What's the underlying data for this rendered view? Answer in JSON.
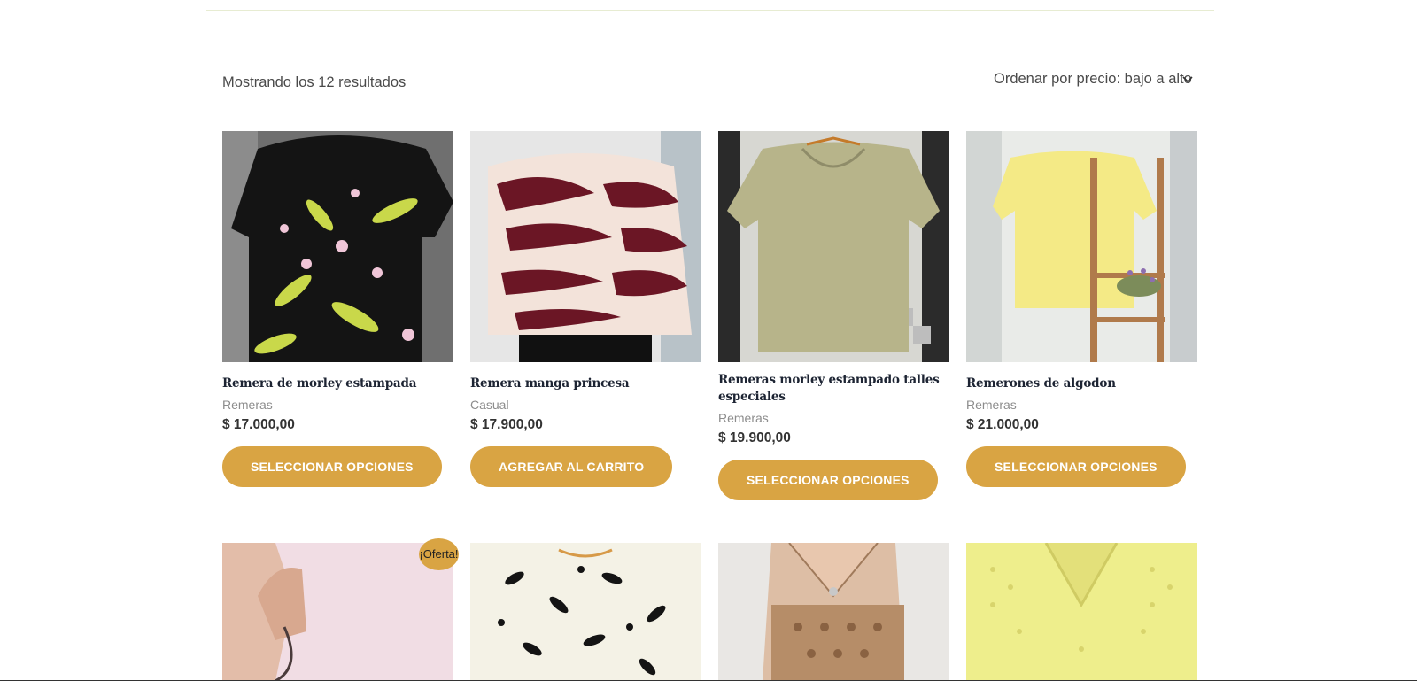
{
  "toolbar": {
    "result_count": "Mostrando los 12 resultados",
    "orderby_selected": "Ordenar por precio: bajo a alto"
  },
  "colors": {
    "accent": "#d9a443",
    "button_text": "#ffffff",
    "title": "#1d2433"
  },
  "products": [
    {
      "title": "Remera de morley estampada",
      "category": "Remeras",
      "price": "$ 17.000,00",
      "button": "SELECCIONAR OPCIONES"
    },
    {
      "title": "Remera manga princesa",
      "category": "Casual",
      "price": "$ 17.900,00",
      "button": "AGREGAR AL CARRITO"
    },
    {
      "title": "Remeras morley estampado talles especiales",
      "category": "Remeras",
      "price": "$ 19.900,00",
      "button": "SELECCIONAR OPCIONES"
    },
    {
      "title": "Remerones de algodon",
      "category": "Remeras",
      "price": "$ 21.000,00",
      "button": "SELECCIONAR OPCIONES"
    }
  ],
  "sale_badge": "¡Oferta!"
}
